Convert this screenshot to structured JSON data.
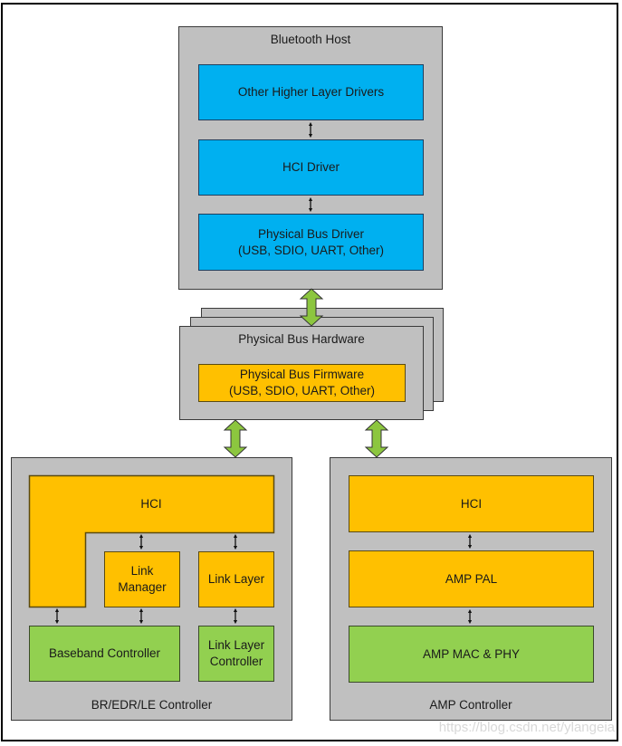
{
  "host": {
    "title": "Bluetooth Host",
    "layers": [
      {
        "label": "Other Higher Layer Drivers"
      },
      {
        "label": "HCI Driver"
      },
      {
        "label": "Physical Bus Driver\n(USB, SDIO, UART, Other)"
      }
    ]
  },
  "bus": {
    "title": "Physical Bus Hardware",
    "firmware": "Physical Bus Firmware\n(USB, SDIO, UART, Other)"
  },
  "bredr": {
    "title": "BR/EDR/LE Controller",
    "hci": "HCI",
    "link_manager": "Link\nManager",
    "link_layer": "Link Layer",
    "baseband": "Baseband Controller",
    "ll_controller": "Link Layer\nController"
  },
  "amp": {
    "title": "AMP Controller",
    "hci": "HCI",
    "pal": "AMP PAL",
    "mac_phy": "AMP MAC & PHY"
  },
  "colors": {
    "host_layer": "#00b0f0",
    "hci_layer": "#ffc000",
    "radio_layer": "#92d050",
    "container": "#c0c0c0",
    "bus_arrow": "#8cc63f"
  },
  "watermark": "https://blog.csdn.net/ylangeia"
}
